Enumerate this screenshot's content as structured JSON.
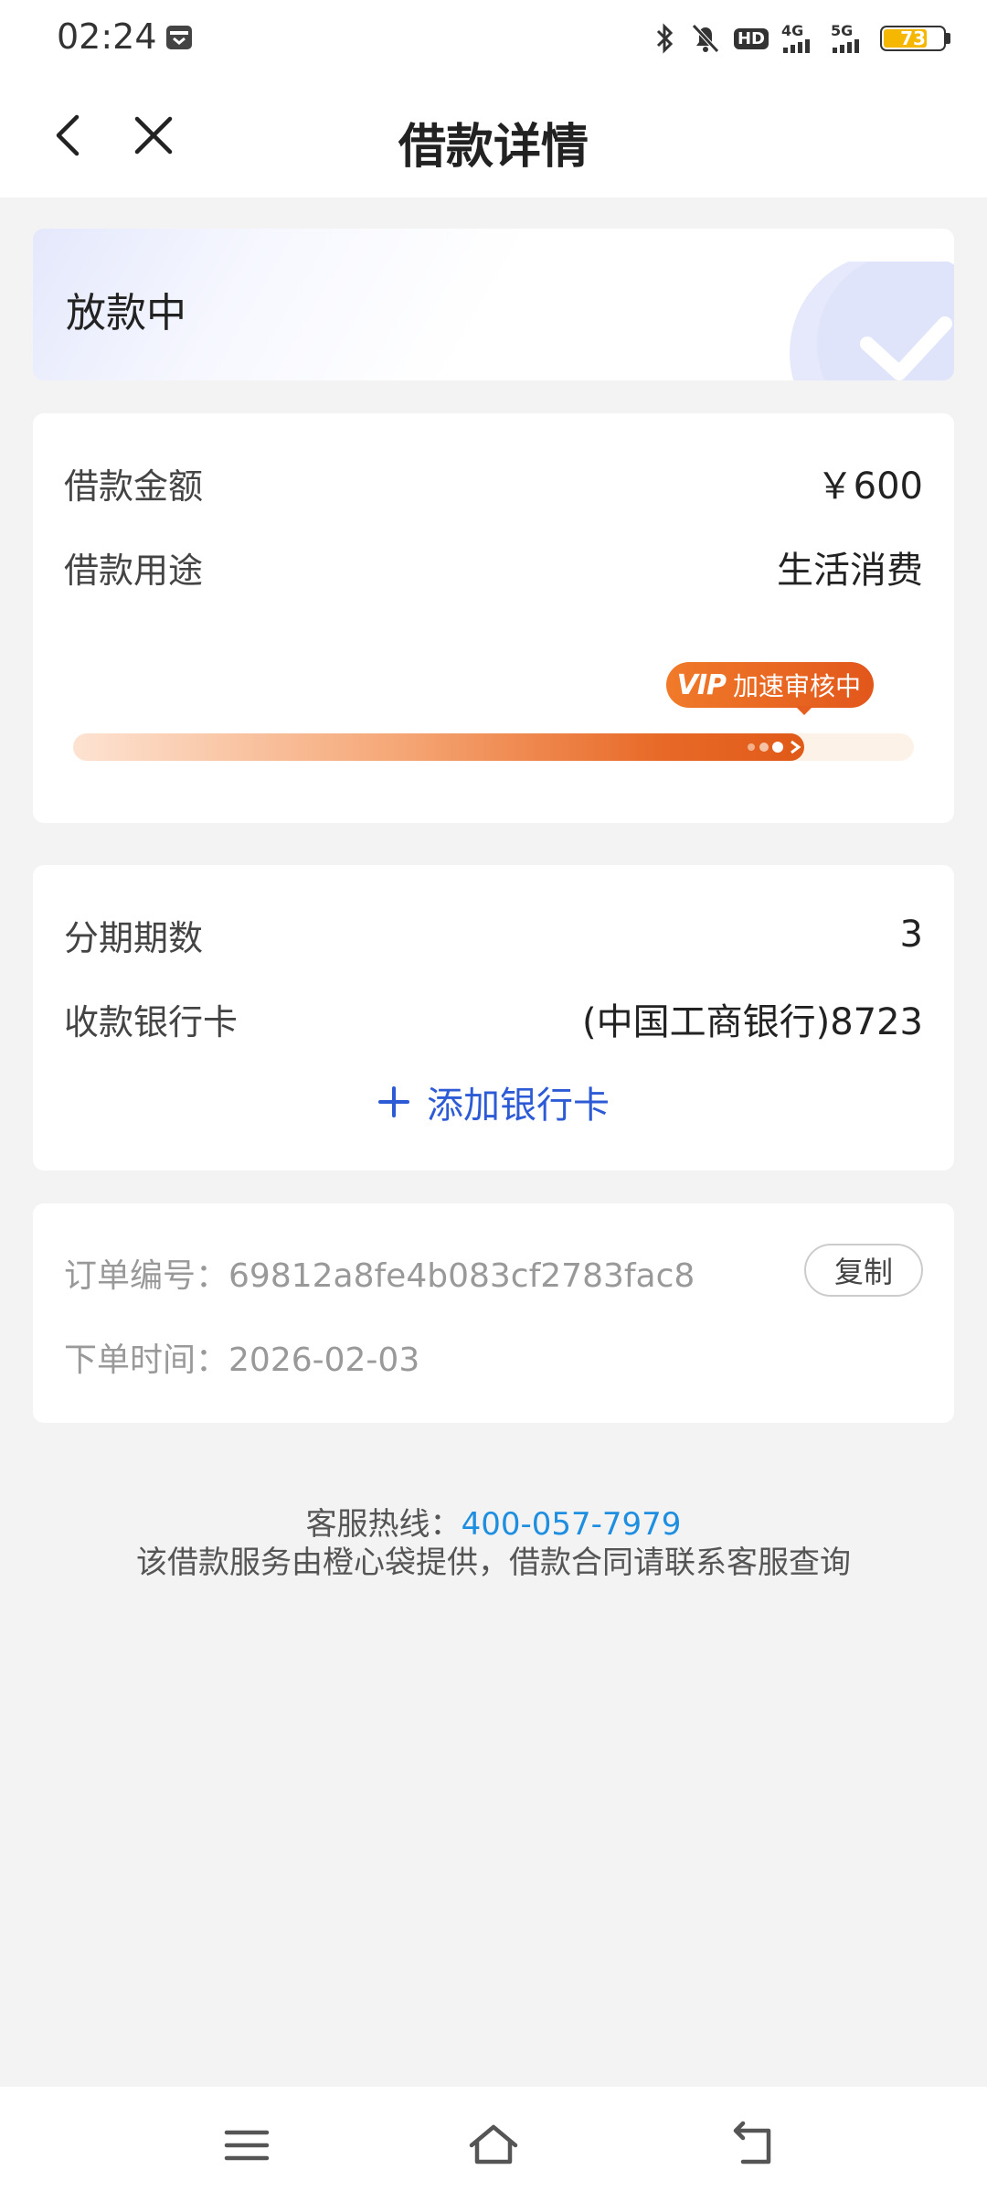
{
  "status_bar": {
    "time": "02:24",
    "battery": "73",
    "network_4g": "4G",
    "network_5g": "5G",
    "hd_label": "HD"
  },
  "header": {
    "title": "借款详情"
  },
  "status_card": {
    "label": "放款中"
  },
  "loan_info": {
    "amount_label": "借款金额",
    "amount_value": "￥600",
    "purpose_label": "借款用途",
    "purpose_value": "生活消费",
    "vip_badge": "VIP",
    "vip_text": "加速审核中",
    "progress": 0.87
  },
  "bank_info": {
    "installments_label": "分期期数",
    "installments_value": "3",
    "card_label": "收款银行卡",
    "card_value": "(中国工商银行)8723",
    "add_card_label": "添加银行卡"
  },
  "order_info": {
    "order_no_label": "订单编号：",
    "order_no_value": "69812a8fe4b083cf2783fac8",
    "copy_label": "复制",
    "order_time_label": "下单时间：",
    "order_time_value": "2026-02-03"
  },
  "footer": {
    "hotline_label": "客服热线：",
    "hotline_number": "400-057-7979",
    "note": "该借款服务由橙心袋提供，借款合同请联系客服查询"
  },
  "colors": {
    "accent_blue": "#2d5bd6",
    "hotline_blue": "#1d8ee0",
    "vip_orange": "#e55e1f",
    "battery_yellow": "#f5b700"
  }
}
